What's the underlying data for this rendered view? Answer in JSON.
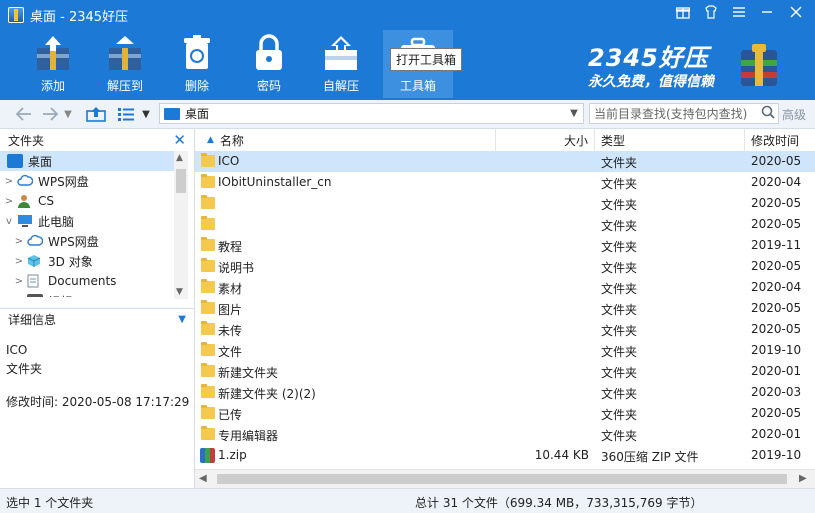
{
  "window": {
    "title": "桌面 - 2345好压",
    "controls": [
      "gift-icon",
      "skin-icon",
      "menu-icon",
      "minimize-icon",
      "maximize-icon",
      "close-icon"
    ]
  },
  "toolbar": {
    "items": [
      {
        "label": "添加",
        "icon": "add-archive-icon"
      },
      {
        "label": "解压到",
        "icon": "extract-to-icon"
      },
      {
        "label": "删除",
        "icon": "recycle-bin-icon"
      },
      {
        "label": "密码",
        "icon": "lock-icon"
      },
      {
        "label": "自解压",
        "icon": "self-extract-icon"
      },
      {
        "label": "工具箱",
        "icon": "toolbox-icon"
      }
    ],
    "tooltip": "打开工具箱"
  },
  "brand": {
    "name": "2345好压",
    "slogan": "永久免费，值得信赖"
  },
  "nav": {
    "address": "桌面",
    "search_placeholder": "当前目录查找(支持包内查找)",
    "advanced": "高级"
  },
  "left_panel": {
    "folders_title": "文件夹",
    "tree": [
      {
        "label": "桌面",
        "level": 0,
        "expander": "",
        "icon": "desktop-icon",
        "selected": true
      },
      {
        "label": "WPS网盘",
        "level": 0,
        "expander": ">",
        "icon": "cloud-icon"
      },
      {
        "label": "CS",
        "level": 0,
        "expander": ">",
        "icon": "user-icon"
      },
      {
        "label": "此电脑",
        "level": 0,
        "expander": "v",
        "icon": "computer-icon"
      },
      {
        "label": "WPS网盘",
        "level": 1,
        "expander": ">",
        "icon": "cloud-icon"
      },
      {
        "label": "3D 对象",
        "level": 1,
        "expander": ">",
        "icon": "3d-objects-icon"
      },
      {
        "label": "Documents",
        "level": 1,
        "expander": ">",
        "icon": "documents-icon"
      },
      {
        "label": "视频",
        "level": 1,
        "expander": ">",
        "icon": "video-icon"
      }
    ],
    "detail_title": "详细信息",
    "detail": {
      "name": "ICO",
      "type": "文件夹",
      "modified": "修改时间:  2020-05-08 17:17:29"
    }
  },
  "file_list": {
    "columns": {
      "name": "名称",
      "size": "大小",
      "type": "类型",
      "date": "修改时间"
    },
    "rows": [
      {
        "name": "ICO",
        "size": "",
        "type": "文件夹",
        "date": "2020-05",
        "kind": "folder",
        "selected": true
      },
      {
        "name": "IObitUninstaller_cn",
        "size": "",
        "type": "文件夹",
        "date": "2020-04",
        "kind": "folder"
      },
      {
        "name": "",
        "size": "",
        "type": "文件夹",
        "date": "2020-05",
        "kind": "folder"
      },
      {
        "name": "",
        "size": "",
        "type": "文件夹",
        "date": "2020-05",
        "kind": "folder"
      },
      {
        "name": "教程",
        "size": "",
        "type": "文件夹",
        "date": "2019-11",
        "kind": "folder"
      },
      {
        "name": "说明书",
        "size": "",
        "type": "文件夹",
        "date": "2020-05",
        "kind": "folder"
      },
      {
        "name": "素材",
        "size": "",
        "type": "文件夹",
        "date": "2020-04",
        "kind": "folder"
      },
      {
        "name": "图片",
        "size": "",
        "type": "文件夹",
        "date": "2020-05",
        "kind": "folder"
      },
      {
        "name": "未传",
        "size": "",
        "type": "文件夹",
        "date": "2020-05",
        "kind": "folder"
      },
      {
        "name": "文件",
        "size": "",
        "type": "文件夹",
        "date": "2019-10",
        "kind": "folder"
      },
      {
        "name": "新建文件夹",
        "size": "",
        "type": "文件夹",
        "date": "2020-01",
        "kind": "folder"
      },
      {
        "name": "新建文件夹 (2)(2)",
        "size": "",
        "type": "文件夹",
        "date": "2020-03",
        "kind": "folder"
      },
      {
        "name": "已传",
        "size": "",
        "type": "文件夹",
        "date": "2020-05",
        "kind": "folder"
      },
      {
        "name": "专用编辑器",
        "size": "",
        "type": "文件夹",
        "date": "2020-01",
        "kind": "folder"
      },
      {
        "name": "1.zip",
        "size": "10.44 KB",
        "type": "360压缩 ZIP 文件",
        "date": "2019-10",
        "kind": "zip"
      }
    ]
  },
  "status": {
    "left": "选中 1 个文件夹",
    "right": "总计 31 个文件（699.34 MB，733,315,769 字节）"
  },
  "colors": {
    "accent": "#1c7ad6",
    "selection": "#cfe5fb",
    "folder": "#f5c84e"
  }
}
